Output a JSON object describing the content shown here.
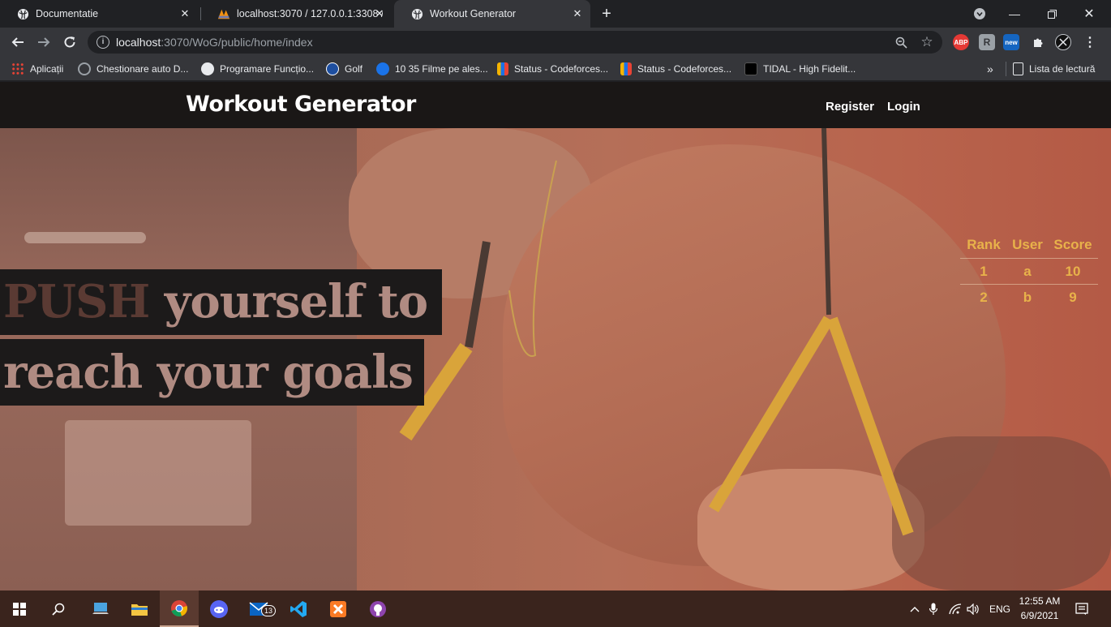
{
  "browser": {
    "tabs": [
      {
        "title": "Documentatie",
        "icon": "globe-icon",
        "active": false
      },
      {
        "title": "localhost:3070 / 127.0.0.1:3308 /",
        "icon": "phpmyadmin-icon",
        "active": false
      },
      {
        "title": "Workout Generator",
        "icon": "globe-icon",
        "active": true
      }
    ],
    "address": {
      "host": "localhost",
      "path": ":3070/WoG/public/home/index"
    },
    "bookmarks": [
      {
        "label": "Aplicații",
        "icon": "apps-grid-icon",
        "color": "#ea4335"
      },
      {
        "label": "Chestionare auto D...",
        "icon": "steering-wheel-icon",
        "color": "#9aa0a6"
      },
      {
        "label": "Programare Funcțio...",
        "icon": "globe-icon",
        "color": "#e8eaed"
      },
      {
        "label": "Golf",
        "icon": "vw-logo-icon",
        "color": "#1e4fa0"
      },
      {
        "label": "10 35 Filme pe ales...",
        "icon": "play-icon",
        "color": "#1a73e8"
      },
      {
        "label": "Status - Codeforces...",
        "icon": "codeforces-icon",
        "color": "#f4b400"
      },
      {
        "label": "Status - Codeforces...",
        "icon": "codeforces-icon",
        "color": "#f4b400"
      },
      {
        "label": "TIDAL - High Fidelit...",
        "icon": "tidal-icon",
        "color": "#000000"
      }
    ],
    "reading_list": "Lista de lectură",
    "overflow": "»"
  },
  "site": {
    "brand": "Workout Generator",
    "nav": {
      "register": "Register",
      "login": "Login"
    },
    "headline": {
      "line1_dark": "PUSH",
      "line1_rest": " yourself to",
      "line2": "reach your goals"
    },
    "leaderboard": {
      "headers": [
        "Rank",
        "User",
        "Score"
      ],
      "rows": [
        {
          "rank": "1",
          "user": "a",
          "score": "10"
        },
        {
          "rank": "2",
          "user": "b",
          "score": "9"
        }
      ]
    }
  },
  "taskbar": {
    "apps": [
      "windows-start-icon",
      "search-icon",
      "this-pc-icon",
      "file-explorer-icon",
      "chrome-icon",
      "discord-icon",
      "mail-icon",
      "vscode-icon",
      "xampp-icon",
      "github-desktop-icon"
    ],
    "mail_badge": "13",
    "language": "ENG",
    "time": "12:55 AM",
    "date": "6/9/2021"
  },
  "colors": {
    "accent_gold": "#e8b24a",
    "hero_tint": "#b56f58",
    "nav_bg": "#1a1716"
  }
}
